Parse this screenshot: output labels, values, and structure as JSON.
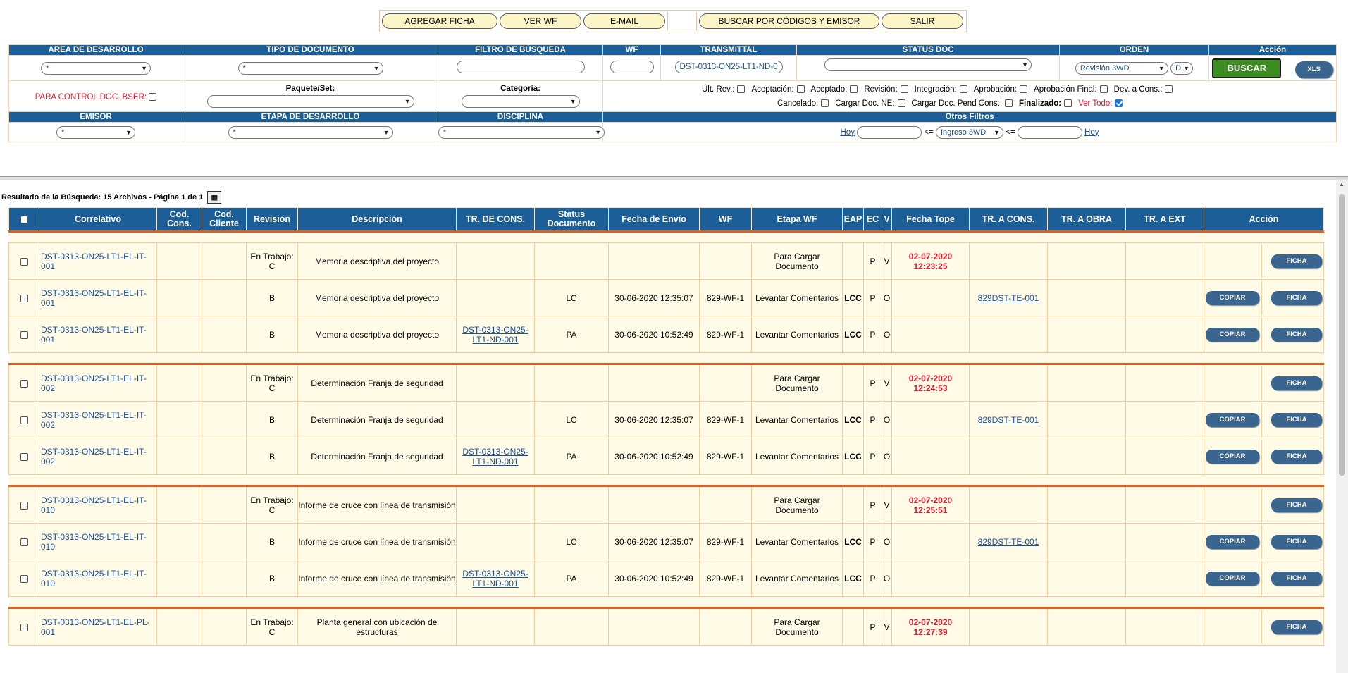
{
  "toolbar": {
    "buttons": [
      "AGREGAR FICHA",
      "VER WF",
      "E-MAIL",
      "BUSCAR POR CÓDIGOS Y EMISOR",
      "SALIR"
    ]
  },
  "filters": {
    "headers1": [
      "AREA DE DESARROLLO",
      "TIPO DE DOCUMENTO",
      "FILTRO DE BÚSQUEDA",
      "WF",
      "TRANSMITTAL",
      "STATUS DOC",
      "ORDEN",
      "Acción"
    ],
    "area_value": "*",
    "tipo_value": "*",
    "filtro_value": "",
    "wf_value": "",
    "transmittal_value": "DST-0313-ON25-LT1-ND-0",
    "status_value": "",
    "orden_value": "Revisión 3WD",
    "orden_dir": "D",
    "buscar_label": "BUSCAR",
    "xls_label": "XLS",
    "control_label": "PARA CONTROL DOC. BSER:",
    "paquete_label": "Paquete/Set:",
    "categoria_label": "Categoría:",
    "checks_row1": [
      {
        "label": "Últ. Rev.:",
        "checked": false
      },
      {
        "label": "Aceptación:",
        "checked": false
      },
      {
        "label": "Aceptado:",
        "checked": false
      },
      {
        "label": "Revisión:",
        "checked": false
      },
      {
        "label": "Integración:",
        "checked": false
      },
      {
        "label": "Aprobación:",
        "checked": false
      },
      {
        "label": "Aprobación Final:",
        "checked": false
      },
      {
        "label": "Dev. a Cons.:",
        "checked": false
      }
    ],
    "checks_row2": [
      {
        "label": "Cancelado:",
        "checked": false
      },
      {
        "label": "Cargar Doc. NE:",
        "checked": false
      },
      {
        "label": "Cargar Doc. Pend Cons.:",
        "checked": false
      },
      {
        "label": "Finalizado:",
        "checked": false
      },
      {
        "label": "Ver Todo:",
        "checked": true
      }
    ],
    "headers3": [
      "EMISOR",
      "ETAPA DE DESARROLLO",
      "DISCIPLINA",
      "Otros Filtros"
    ],
    "emisor_value": "*",
    "etapa_value": "*",
    "disciplina_value": "*",
    "hoy_label": "Hoy",
    "lte": "<=",
    "ingreso_value": "Ingreso 3WD"
  },
  "result_text": "Resultado de la Búsqueda: 15 Archivos - Página 1 de 1",
  "grid": {
    "headers": [
      "",
      "Correlativo",
      "Cod. Cons.",
      "Cod. Cliente",
      "Revisión",
      "Descripción",
      "TR. DE CONS.",
      "Status Documento",
      "Fecha de Envío",
      "WF",
      "Etapa WF",
      "EAP",
      "EC",
      "V",
      "Fecha Tope",
      "TR. A CONS.",
      "TR. A OBRA",
      "TR. A EXT",
      "Acción"
    ],
    "copiar_label": "COPIAR",
    "ficha_label": "FICHA",
    "groups": [
      {
        "rows": [
          {
            "corr": "DST-0313-ON25-LT1-EL-IT-001",
            "rev": "En Trabajo: C",
            "desc": "Memoria descriptiva del proyecto",
            "trcons": "",
            "status": "",
            "fecha": "",
            "wf": "",
            "etapa": "Para Cargar Documento",
            "eap": "",
            "ec": "P",
            "v": "V",
            "tope": "02-07-2020 12:23:25",
            "tracons": "",
            "copiar": false
          },
          {
            "corr": "DST-0313-ON25-LT1-EL-IT-001",
            "rev": "B",
            "desc": "Memoria descriptiva del proyecto",
            "trcons": "",
            "status": "LC",
            "fecha": "30-06-2020 12:35:07",
            "wf": "829-WF-1",
            "etapa": "Levantar Comentarios",
            "eap": "LCC",
            "ec": "P",
            "v": "O",
            "tope": "",
            "tracons": "829DST-TE-001",
            "copiar": true
          },
          {
            "corr": "DST-0313-ON25-LT1-EL-IT-001",
            "rev": "B",
            "desc": "Memoria descriptiva del proyecto",
            "trcons": "DST-0313-ON25-LT1-ND-001",
            "status": "PA",
            "fecha": "30-06-2020 10:52:49",
            "wf": "829-WF-1",
            "etapa": "Levantar Comentarios",
            "eap": "LCC",
            "ec": "P",
            "v": "O",
            "tope": "",
            "tracons": "",
            "copiar": true
          }
        ]
      },
      {
        "rows": [
          {
            "corr": "DST-0313-ON25-LT1-EL-IT-002",
            "rev": "En Trabajo: C",
            "desc": "Determinación Franja de seguridad",
            "trcons": "",
            "status": "",
            "fecha": "",
            "wf": "",
            "etapa": "Para Cargar Documento",
            "eap": "",
            "ec": "P",
            "v": "V",
            "tope": "02-07-2020 12:24:53",
            "tracons": "",
            "copiar": false
          },
          {
            "corr": "DST-0313-ON25-LT1-EL-IT-002",
            "rev": "B",
            "desc": "Determinación Franja de seguridad",
            "trcons": "",
            "status": "LC",
            "fecha": "30-06-2020 12:35:07",
            "wf": "829-WF-1",
            "etapa": "Levantar Comentarios",
            "eap": "LCC",
            "ec": "P",
            "v": "O",
            "tope": "",
            "tracons": "829DST-TE-001",
            "copiar": true
          },
          {
            "corr": "DST-0313-ON25-LT1-EL-IT-002",
            "rev": "B",
            "desc": "Determinación Franja de seguridad",
            "trcons": "DST-0313-ON25-LT1-ND-001",
            "status": "PA",
            "fecha": "30-06-2020 10:52:49",
            "wf": "829-WF-1",
            "etapa": "Levantar Comentarios",
            "eap": "LCC",
            "ec": "P",
            "v": "O",
            "tope": "",
            "tracons": "",
            "copiar": true
          }
        ]
      },
      {
        "rows": [
          {
            "corr": "DST-0313-ON25-LT1-EL-IT-010",
            "rev": "En Trabajo: C",
            "desc": "Informe de cruce con línea de transmisión",
            "trcons": "",
            "status": "",
            "fecha": "",
            "wf": "",
            "etapa": "Para Cargar Documento",
            "eap": "",
            "ec": "P",
            "v": "V",
            "tope": "02-07-2020 12:25:51",
            "tracons": "",
            "copiar": false
          },
          {
            "corr": "DST-0313-ON25-LT1-EL-IT-010",
            "rev": "B",
            "desc": "Informe de cruce con línea de transmisión",
            "trcons": "",
            "status": "LC",
            "fecha": "30-06-2020 12:35:07",
            "wf": "829-WF-1",
            "etapa": "Levantar Comentarios",
            "eap": "LCC",
            "ec": "P",
            "v": "O",
            "tope": "",
            "tracons": "829DST-TE-001",
            "copiar": true
          },
          {
            "corr": "DST-0313-ON25-LT1-EL-IT-010",
            "rev": "B",
            "desc": "Informe de cruce con línea de transmisión",
            "trcons": "DST-0313-ON25-LT1-ND-001",
            "status": "PA",
            "fecha": "30-06-2020 10:52:49",
            "wf": "829-WF-1",
            "etapa": "Levantar Comentarios",
            "eap": "LCC",
            "ec": "P",
            "v": "O",
            "tope": "",
            "tracons": "",
            "copiar": true
          }
        ]
      },
      {
        "rows": [
          {
            "corr": "DST-0313-ON25-LT1-EL-PL-001",
            "rev": "En Trabajo: C",
            "desc": "Planta general con ubicación de estructuras",
            "trcons": "",
            "status": "",
            "fecha": "",
            "wf": "",
            "etapa": "Para Cargar Documento",
            "eap": "",
            "ec": "P",
            "v": "V",
            "tope": "02-07-2020 12:27:39",
            "tracons": "",
            "copiar": false
          }
        ]
      }
    ]
  }
}
